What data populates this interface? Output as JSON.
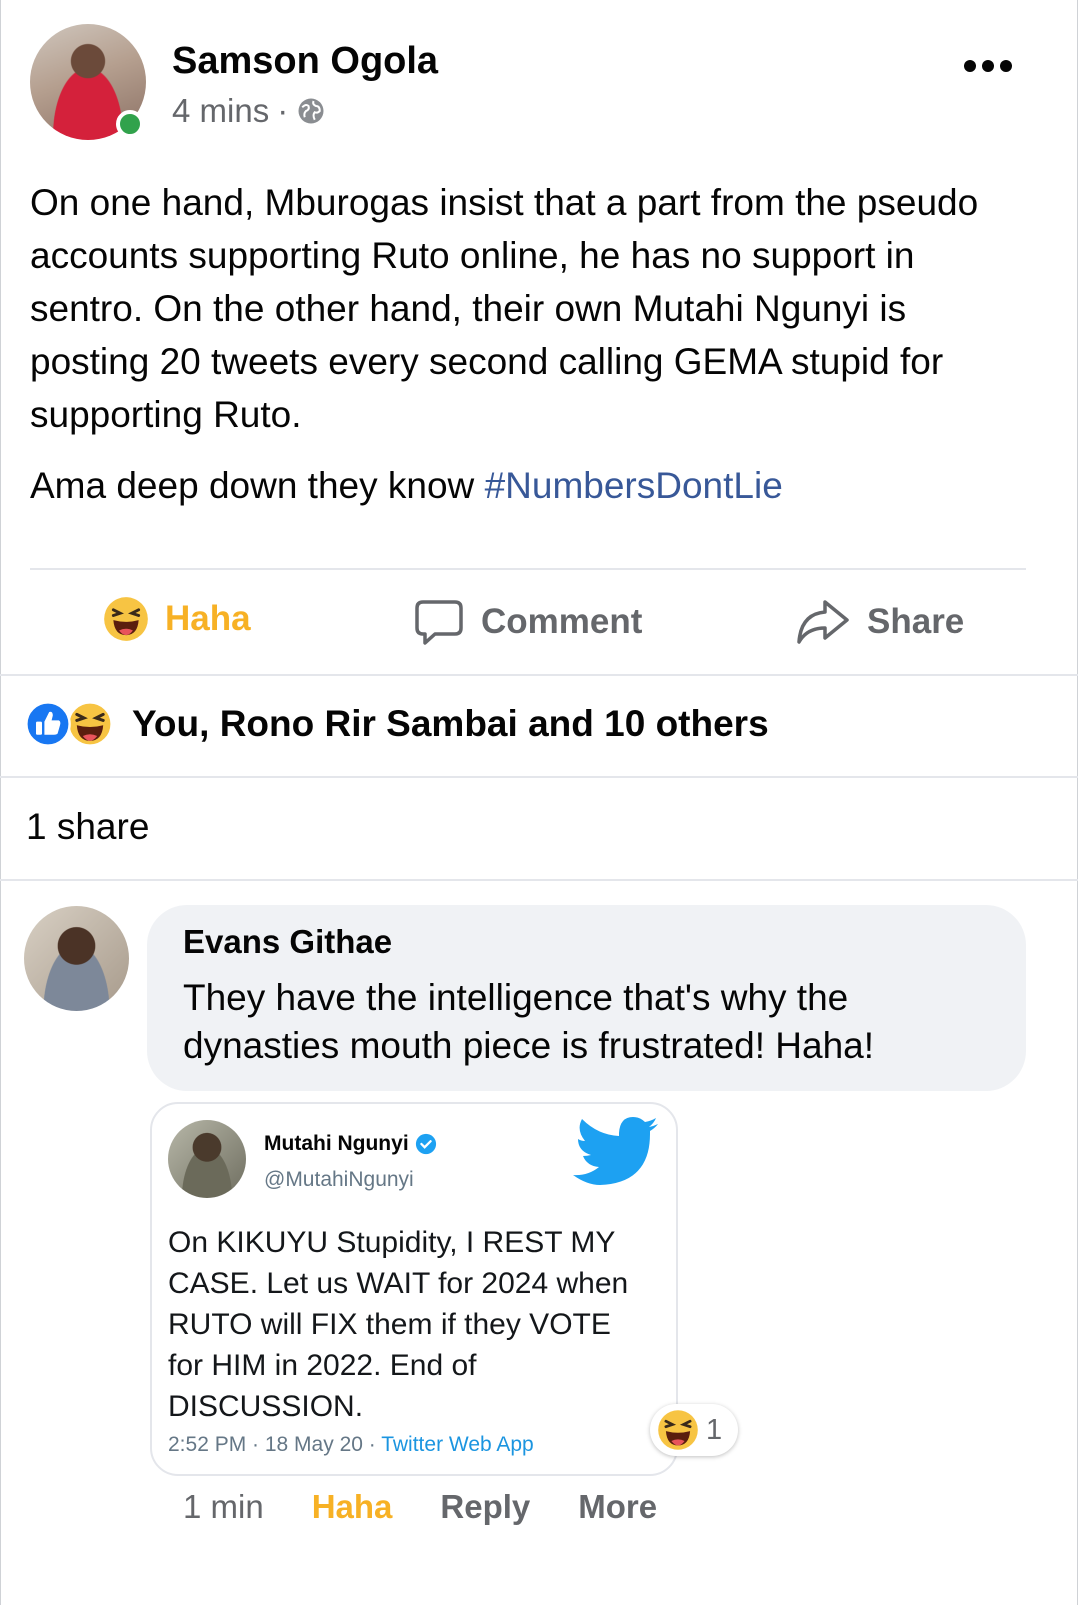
{
  "post": {
    "author": "Samson Ogola",
    "time": "4 mins",
    "separator": "·",
    "paragraph1": "On one hand, Mburogas insist that a part from the pseudo accounts supporting Ruto online, he has no support in sentro. On the other hand, their own Mutahi Ngunyi is posting 20 tweets every second calling GEMA stupid for supporting Ruto.",
    "paragraph2_text": "Ama deep down they know ",
    "hashtag": "#NumbersDontLie"
  },
  "actions": {
    "haha": "Haha",
    "comment": "Comment",
    "share": "Share"
  },
  "reactions": {
    "summary": "You, Rono Rir Sambai and 10 others"
  },
  "shares": {
    "count_text": "1 share"
  },
  "comment": {
    "author": "Evans Githae",
    "text": "They have the intelligence that's why the dynasties mouth piece is frustrated! Haha!",
    "time": "1 min",
    "haha": "Haha",
    "reply": "Reply",
    "more": "More",
    "reaction_count": "1"
  },
  "tweet": {
    "name": "Mutahi Ngunyi",
    "handle": "@MutahiNgunyi",
    "text": "On KIKUYU Stupidity, I REST MY CASE. Let us WAIT for 2024 when RUTO will FIX them if they VOTE for HIM in 2022. End of DISCUSSION.",
    "time": "2:52 PM · 18 May 20 · ",
    "source": "Twitter Web App"
  },
  "colors": {
    "haha": "#f7b125",
    "like": "#1877f2",
    "online": "#31a24c",
    "hashtag": "#385898",
    "twitter": "#1da1f2"
  }
}
